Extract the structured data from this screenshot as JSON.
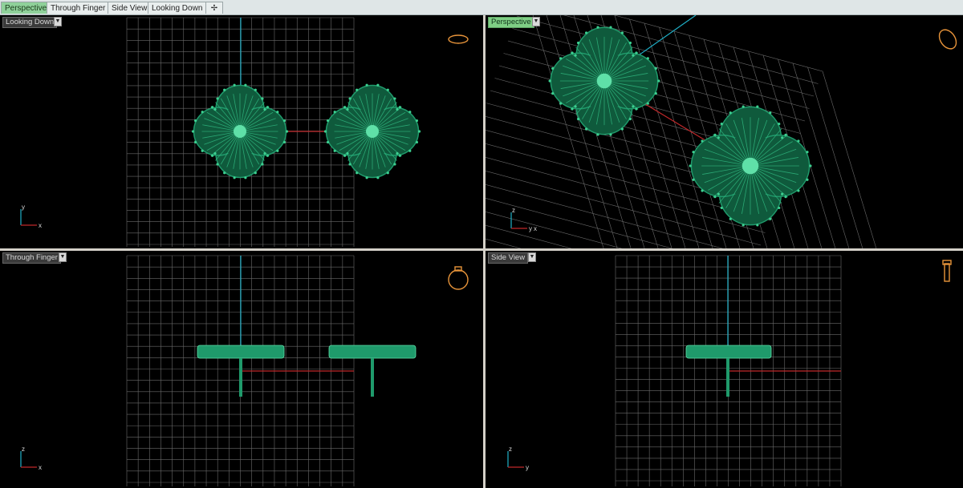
{
  "tabs": [
    {
      "label": "Perspective",
      "active": true
    },
    {
      "label": "Through Finger",
      "active": false
    },
    {
      "label": "Side View",
      "active": false
    },
    {
      "label": "Looking Down",
      "active": false
    }
  ],
  "add_tab_icon": "new-tab-icon",
  "viewports": {
    "top_left": {
      "label": "Looking Down"
    },
    "top_right": {
      "label": "Perspective"
    },
    "bottom_left": {
      "label": "Through Finger"
    },
    "bottom_right": {
      "label": "Side View"
    }
  },
  "axis_labels": {
    "top_left": [
      "y",
      "x"
    ],
    "top_right": [
      "z",
      "y",
      "x"
    ],
    "bottom_left": [
      "z",
      "x"
    ],
    "bottom_right": [
      "z",
      "y"
    ]
  },
  "colors": {
    "viewport_bg": "#000000",
    "grid": "#6a6a6a",
    "model": "#1f9a6b",
    "axis_x": "#c0282a",
    "axis_y": "#1fb0c8",
    "active_label": "#7fcf85",
    "gizmo": "#e8943a"
  }
}
